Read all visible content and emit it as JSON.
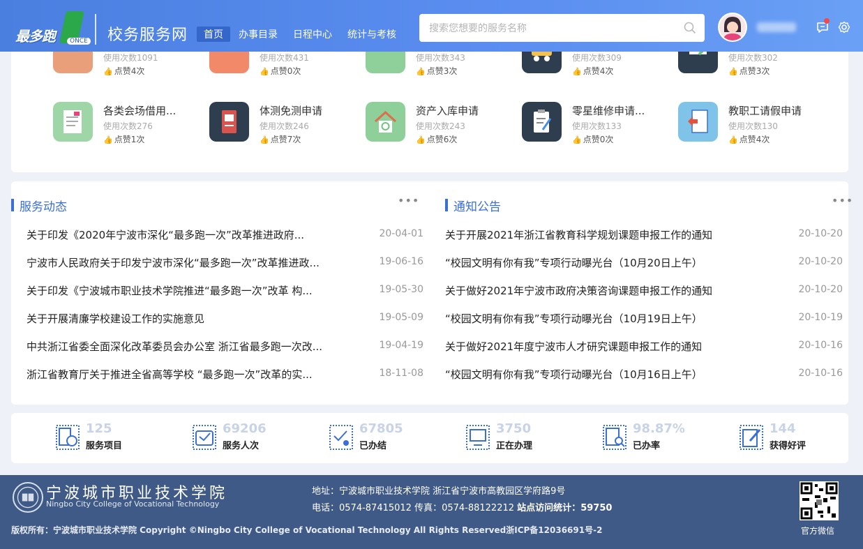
{
  "header": {
    "logo_text": "最多跑",
    "logo_once": "ONCE",
    "site_title": "校务服务网",
    "nav": [
      "首页",
      "办事目录",
      "日程中心",
      "统计与考核"
    ],
    "search_placeholder": "搜索您想要的服务名称"
  },
  "services": [
    {
      "name": "",
      "uses": "使用次数1091",
      "likes": "点赞4次",
      "color": "#e9a07a"
    },
    {
      "name": "",
      "uses": "使用次数431",
      "likes": "点赞0次",
      "color": "#f28a6a"
    },
    {
      "name": "",
      "uses": "使用次数343",
      "likes": "点赞3次",
      "color": "#8fcf9a"
    },
    {
      "name": "",
      "uses": "使用次数309",
      "likes": "点赞4次",
      "color": "#2f3e4f"
    },
    {
      "name": "",
      "uses": "使用次数302",
      "likes": "点赞3次",
      "color": "#2f3e4f"
    },
    {
      "name": "各类会场借用...",
      "uses": "使用次数276",
      "likes": "点赞1次",
      "color": "#9fd6a8"
    },
    {
      "name": "体测免测申请",
      "uses": "使用次数246",
      "likes": "点赞7次",
      "color": "#2f3e4f"
    },
    {
      "name": "资产入库申请",
      "uses": "使用次数243",
      "likes": "点赞6次",
      "color": "#8fcf9a"
    },
    {
      "name": "零星维修申请...",
      "uses": "使用次数133",
      "likes": "点赞0次",
      "color": "#2f3e4f"
    },
    {
      "name": "教职工请假申请",
      "uses": "使用次数130",
      "likes": "点赞4次",
      "color": "#7fc4e8"
    }
  ],
  "service_dynamics": {
    "title": "服务动态",
    "more": "•••",
    "items": [
      {
        "title": "关于印发《2020年宁波市深化“最多跑一次”改革推进政府...",
        "date": "20-04-01"
      },
      {
        "title": "宁波市人民政府关于印发宁波市深化“最多跑一次”改革推进政...",
        "date": "19-06-16"
      },
      {
        "title": "关于印发《宁波城市职业技术学院推进“最多跑一次”改革 构...",
        "date": "19-05-30"
      },
      {
        "title": "关于开展清廉学校建设工作的实施意见",
        "date": "19-05-09"
      },
      {
        "title": "中共浙江省委全面深化改革委员会办公室 浙江省最多跑一次改...",
        "date": "19-04-19"
      },
      {
        "title": "浙江省教育厅关于推进全省高等学校 “最多跑一次”改革的实...",
        "date": "18-11-08"
      }
    ]
  },
  "notices": {
    "title": "通知公告",
    "more": "•••",
    "items": [
      {
        "title": "关于开展2021年浙江省教育科学规划课题申报工作的通知",
        "date": "20-10-20"
      },
      {
        "title": "“校园文明有你有我”专项行动曝光台（10月20日上午）",
        "date": "20-10-20"
      },
      {
        "title": "关于做好2021年宁波市政府决策咨询课题申报工作的通知",
        "date": "20-10-20"
      },
      {
        "title": "“校园文明有你有我”专项行动曝光台（10月19日上午）",
        "date": "20-10-19"
      },
      {
        "title": "关于做好2021年度宁波市人才研究课题申报工作的通知",
        "date": "20-10-16"
      },
      {
        "title": "“校园文明有你有我”专项行动曝光台（10月16日上午）",
        "date": "20-10-16"
      }
    ]
  },
  "stats": [
    {
      "num": "125",
      "label": "服务项目",
      "icon": "service-list-icon"
    },
    {
      "num": "69206",
      "label": "服务人次",
      "icon": "inbox-icon"
    },
    {
      "num": "67805",
      "label": "已办结",
      "icon": "done-user-icon"
    },
    {
      "num": "3750",
      "label": "正在办理",
      "icon": "monitor-icon"
    },
    {
      "num": "98.87%",
      "label": "已办率",
      "icon": "search-doc-icon"
    },
    {
      "num": "144",
      "label": "获得好评",
      "icon": "edit-icon"
    }
  ],
  "footer": {
    "name_cn": "宁波城市职业技术学院",
    "name_en": "Ningbo City College of Vocational Technology",
    "address": "地址：宁波城市职业技术学院 浙江省宁波市高教园区学府路9号",
    "tel": "电话：0574-87415012 传真：0574-88122212",
    "visits_label": "站点访问统计：",
    "visits": "59750",
    "copyright": "版权所有：宁波城市职业技术学院 Copyright ©Ningbo City College of Vocational Technology All Rights Reserved浙ICP备12036691号-2",
    "qr_label": "官方微信"
  }
}
